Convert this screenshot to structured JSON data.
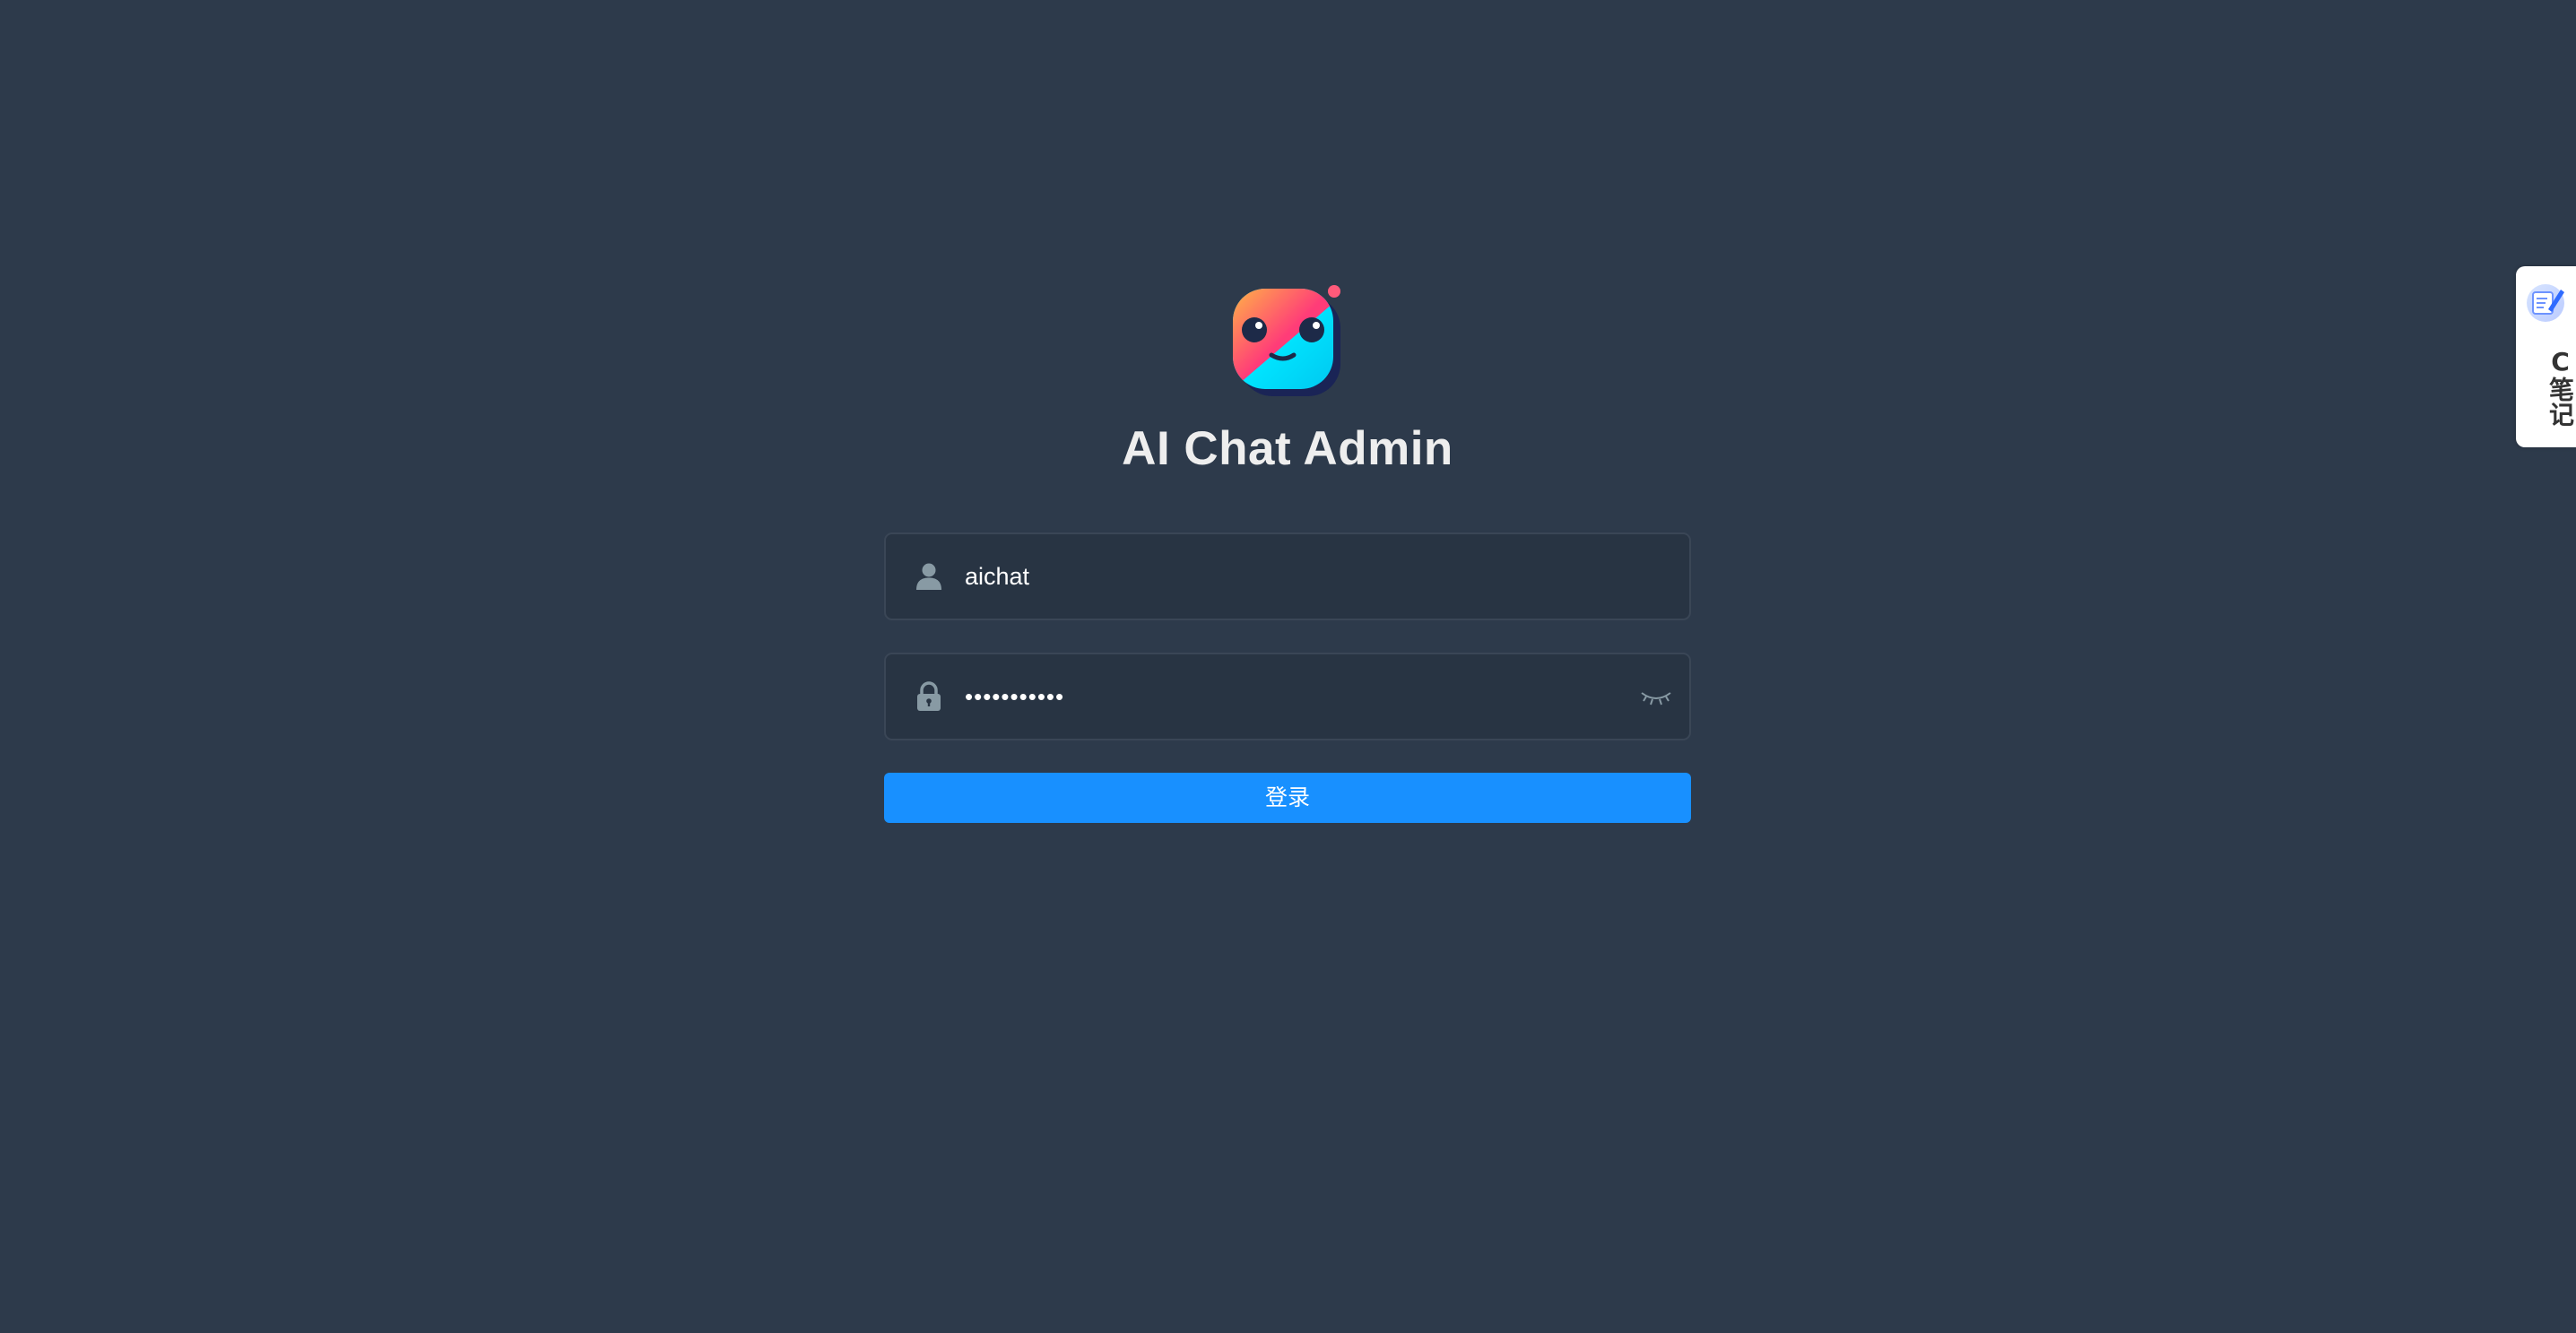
{
  "app": {
    "title": "AI Chat Admin"
  },
  "form": {
    "username": {
      "value": "aichat",
      "icon": "user-icon"
    },
    "password": {
      "masked_value": "•••••••••••",
      "icon": "lock-icon",
      "toggle_icon": "eye-closed-icon"
    },
    "submit_label": "登录"
  },
  "side_widget": {
    "icon": "notebook-pen-icon",
    "label": "C笔记"
  },
  "colors": {
    "background": "#2d3a4b",
    "input_background": "#283443",
    "primary": "#1890ff",
    "title_text": "#eeeeee",
    "icon_gray": "#889aa4"
  }
}
